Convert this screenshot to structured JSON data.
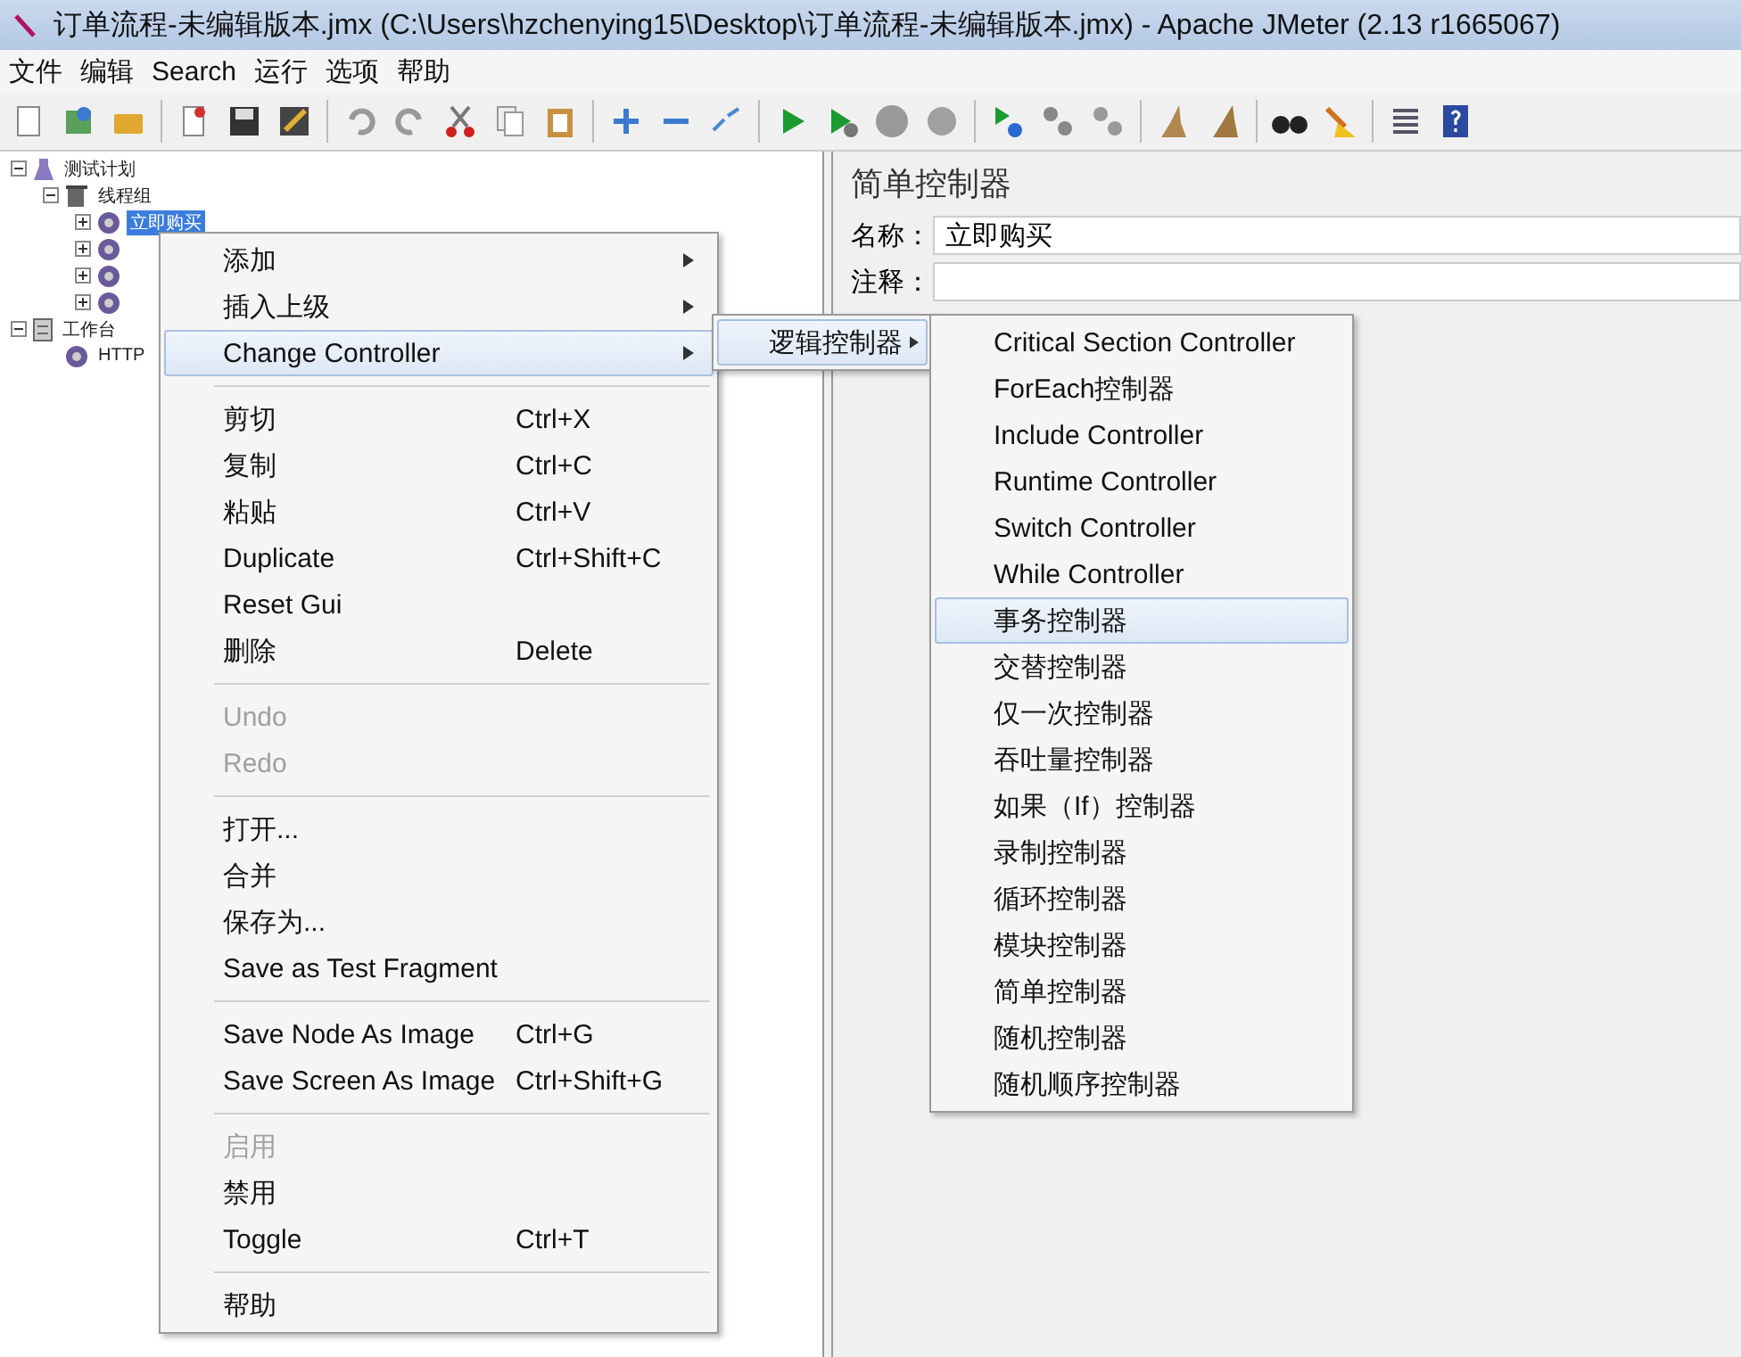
{
  "window": {
    "title": "订单流程-未编辑版本.jmx (C:\\Users\\hzchenying15\\Desktop\\订单流程-未编辑版本.jmx) - Apache JMeter (2.13 r1665067)"
  },
  "menu_bar": [
    "文件",
    "编辑",
    "Search",
    "运行",
    "选项",
    "帮助"
  ],
  "tree": [
    {
      "label": "测试计划",
      "kind": "plan",
      "expanded": true,
      "children": [
        {
          "label": "线程组",
          "kind": "group",
          "expanded": true,
          "children": [
            {
              "label": "立即购买",
              "kind": "controller",
              "expanded": false,
              "selected": true
            },
            {
              "kind": "controller",
              "expanded": false
            },
            {
              "kind": "controller",
              "expanded": false
            },
            {
              "kind": "controller",
              "expanded": false
            }
          ]
        }
      ]
    },
    {
      "label": "工作台",
      "kind": "bench",
      "expanded": true,
      "children": [
        {
          "label": "HTTP",
          "kind": "controller",
          "selected": false
        }
      ]
    }
  ],
  "panel": {
    "title": "简单控制器",
    "name_label": "名称：",
    "name_value": "立即购买",
    "comment_label": "注释："
  },
  "context_menu": [
    {
      "kind": "item",
      "label": "添加",
      "submenu": true,
      "selected": false,
      "disabled": false
    },
    {
      "kind": "item",
      "label": "插入上级",
      "submenu": true,
      "selected": false,
      "disabled": false
    },
    {
      "kind": "item",
      "label": "Change Controller",
      "submenu": true,
      "selected": true,
      "disabled": false
    },
    {
      "kind": "separator"
    },
    {
      "kind": "item",
      "label": "剪切",
      "shortcut": "Ctrl+X",
      "selected": false,
      "disabled": false
    },
    {
      "kind": "item",
      "label": "复制",
      "shortcut": "Ctrl+C",
      "selected": false,
      "disabled": false
    },
    {
      "kind": "item",
      "label": "粘贴",
      "shortcut": "Ctrl+V",
      "selected": false,
      "disabled": false
    },
    {
      "kind": "item",
      "label": "Duplicate",
      "shortcut": "Ctrl+Shift+C",
      "selected": false,
      "disabled": false
    },
    {
      "kind": "item",
      "label": "Reset Gui",
      "selected": false,
      "disabled": false
    },
    {
      "kind": "item",
      "label": "删除",
      "shortcut": "Delete",
      "selected": false,
      "disabled": false
    },
    {
      "kind": "separator"
    },
    {
      "kind": "item",
      "label": "Undo",
      "selected": false,
      "disabled": true
    },
    {
      "kind": "item",
      "label": "Redo",
      "selected": false,
      "disabled": true
    },
    {
      "kind": "separator"
    },
    {
      "kind": "item",
      "label": "打开...",
      "selected": false,
      "disabled": false
    },
    {
      "kind": "item",
      "label": "合并",
      "selected": false,
      "disabled": false
    },
    {
      "kind": "item",
      "label": "保存为...",
      "selected": false,
      "disabled": false
    },
    {
      "kind": "item",
      "label": "Save as Test Fragment",
      "selected": false,
      "disabled": false
    },
    {
      "kind": "separator"
    },
    {
      "kind": "item",
      "label": "Save Node As Image",
      "shortcut": "Ctrl+G",
      "selected": false,
      "disabled": false
    },
    {
      "kind": "item",
      "label": "Save Screen As Image",
      "shortcut": "Ctrl+Shift+G",
      "selected": false,
      "disabled": false
    },
    {
      "kind": "separator"
    },
    {
      "kind": "item",
      "label": "启用",
      "selected": false,
      "disabled": true
    },
    {
      "kind": "item",
      "label": "禁用",
      "selected": false,
      "disabled": false
    },
    {
      "kind": "item",
      "label": "Toggle",
      "shortcut": "Ctrl+T",
      "selected": false,
      "disabled": false
    },
    {
      "kind": "separator"
    },
    {
      "kind": "item",
      "label": "帮助",
      "selected": false,
      "disabled": false
    }
  ],
  "submenu": [
    {
      "label": "逻辑控制器",
      "submenu": true,
      "selected": true
    }
  ],
  "controller_menu": [
    {
      "label": "Critical Section Controller",
      "selected": false
    },
    {
      "label": "ForEach控制器",
      "selected": false
    },
    {
      "label": "Include Controller",
      "selected": false
    },
    {
      "label": "Runtime Controller",
      "selected": false
    },
    {
      "label": "Switch Controller",
      "selected": false
    },
    {
      "label": "While Controller",
      "selected": false
    },
    {
      "label": "事务控制器",
      "selected": true
    },
    {
      "label": "交替控制器",
      "selected": false
    },
    {
      "label": "仅一次控制器",
      "selected": false
    },
    {
      "label": "吞吐量控制器",
      "selected": false
    },
    {
      "label": "如果（If）控制器",
      "selected": false
    },
    {
      "label": "录制控制器",
      "selected": false
    },
    {
      "label": "循环控制器",
      "selected": false
    },
    {
      "label": "模块控制器",
      "selected": false
    },
    {
      "label": "简单控制器",
      "selected": false
    },
    {
      "label": "随机控制器",
      "selected": false
    },
    {
      "label": "随机顺序控制器",
      "selected": false
    }
  ]
}
